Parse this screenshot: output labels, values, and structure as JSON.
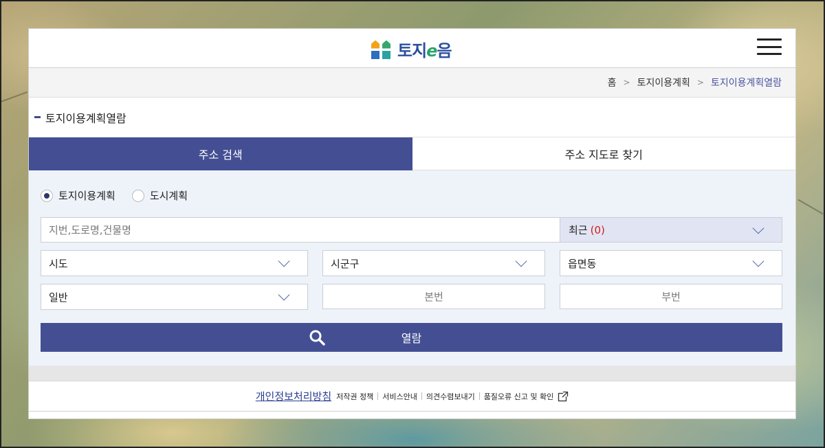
{
  "header": {
    "logo_text": "토지",
    "logo_e": "e",
    "logo_suffix": "음"
  },
  "breadcrumb": {
    "home": "홈",
    "level1": "토지이용계획",
    "current": "토지이용계획열람"
  },
  "page": {
    "title": "토지이용계획열람"
  },
  "tabs": [
    {
      "label": "주소 검색",
      "active": true
    },
    {
      "label": "주소 지도로 찾기",
      "active": false
    }
  ],
  "radios": [
    {
      "label": "토지이용계획",
      "checked": true
    },
    {
      "label": "도시계획",
      "checked": false
    }
  ],
  "search": {
    "placeholder": "지번,도로명,건물명",
    "recent_label": "최근",
    "recent_count": "(0)"
  },
  "selects": {
    "sido": "시도",
    "sigungu": "시군구",
    "eupmyeondong": "읍면동",
    "type": "일반"
  },
  "inputs": {
    "bonbeon": "본번",
    "bubeon": "부번"
  },
  "view_button": "열람",
  "footer": {
    "privacy": "개인정보처리방침",
    "copyright": "저작권 정책",
    "service": "서비스안내",
    "opinion": "의견수렴보내기",
    "quality": "품질오류 신고 및 확인"
  },
  "colors": {
    "primary": "#444f93",
    "recent_bg": "#e1e4f3",
    "count_red": "#d31b1b",
    "search_area_bg": "#eef3fa"
  }
}
